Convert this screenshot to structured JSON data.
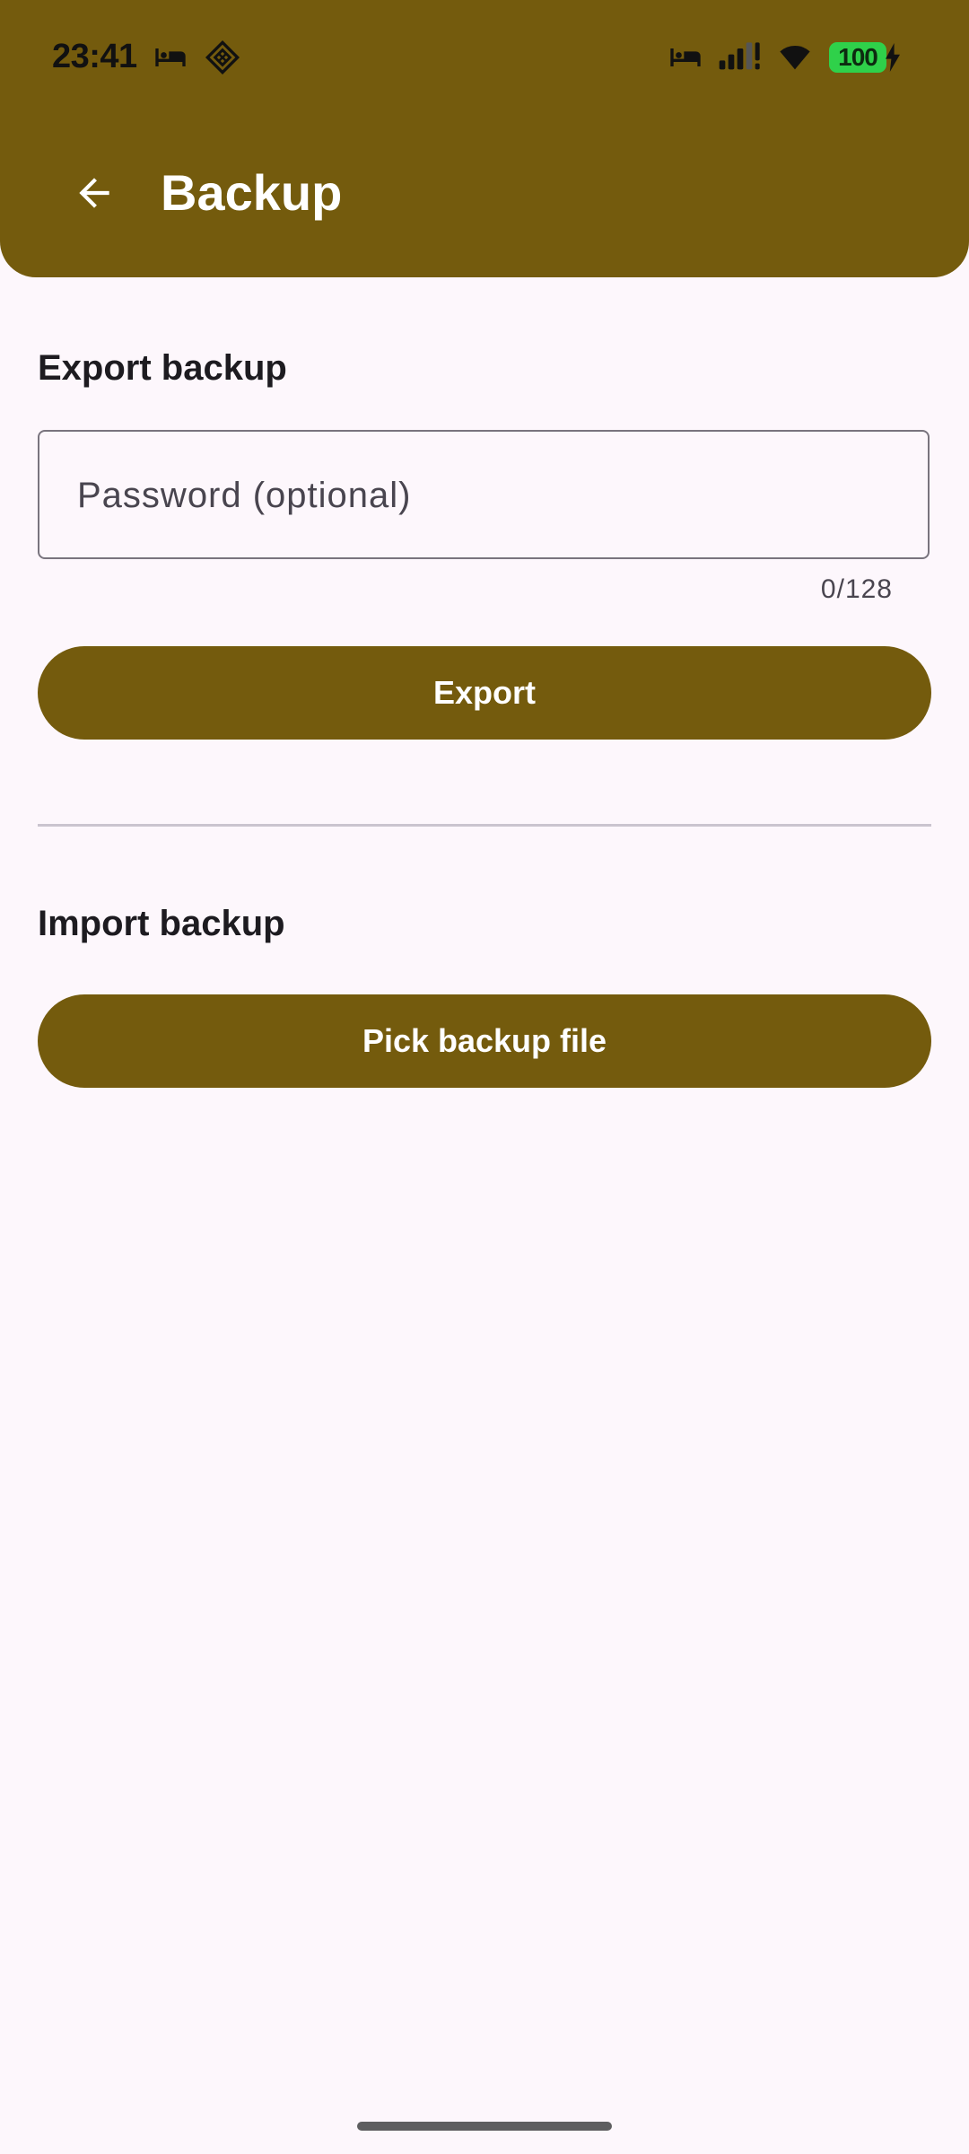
{
  "status_bar": {
    "time": "23:41",
    "battery_level": "100",
    "icons": [
      "bed-icon",
      "diamond-icon",
      "bed-icon",
      "signal-icon",
      "wifi-icon",
      "battery-icon",
      "charging-icon"
    ]
  },
  "app_bar": {
    "title": "Backup",
    "back_icon": "arrow-back-icon",
    "color": "#745b0d"
  },
  "export_section": {
    "title": "Export backup",
    "password_placeholder": "Password (optional)",
    "password_value": "",
    "counter": "0/128",
    "export_label": "Export"
  },
  "import_section": {
    "title": "Import backup",
    "pick_label": "Pick backup file"
  }
}
